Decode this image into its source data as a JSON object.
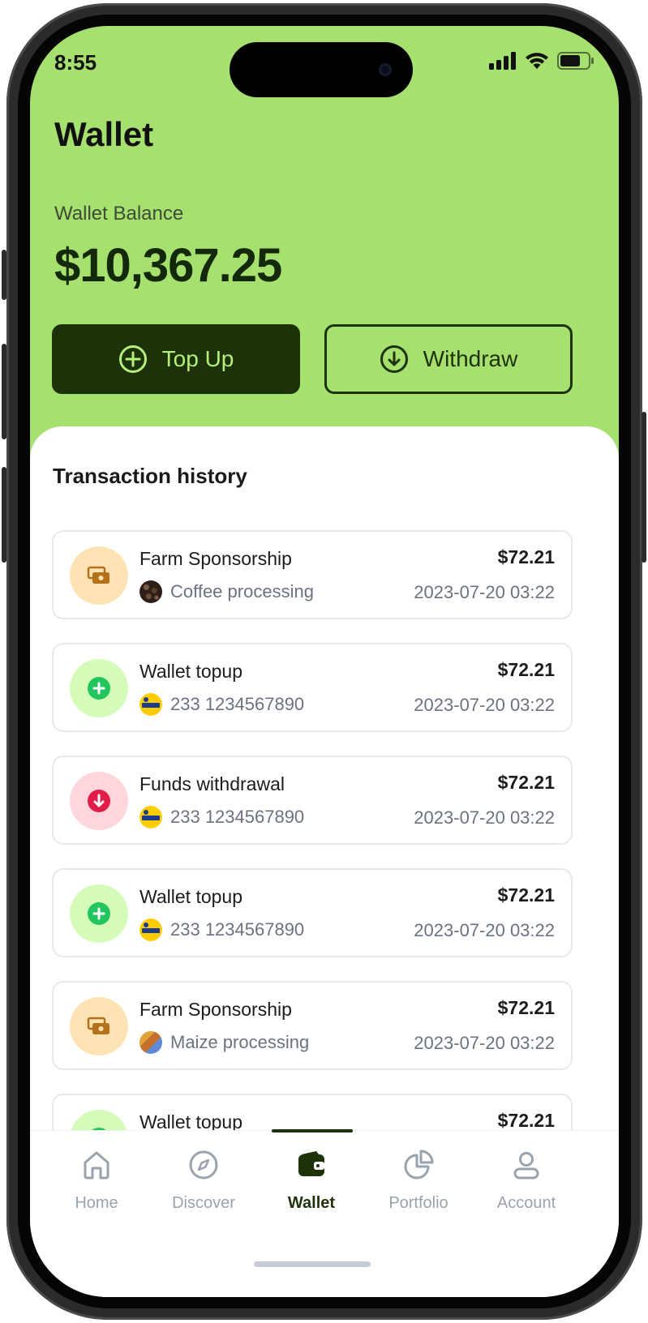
{
  "status_bar": {
    "time": "8:55",
    "icons": [
      "signal-icon",
      "wifi-icon",
      "battery-icon"
    ]
  },
  "header": {
    "title": "Wallet",
    "balance_label": "Wallet Balance",
    "balance": "$10,367.25"
  },
  "actions": {
    "top_up_label": "Top Up",
    "withdraw_label": "Withdraw"
  },
  "history": {
    "title": "Transaction history",
    "items": [
      {
        "name": "Farm Sponsorship",
        "detail": "Coffee processing",
        "amount": "$72.21",
        "date": "2023-07-20 03:22",
        "kind": "sponsorship",
        "icon": "cash-icon",
        "thumb": "coffee-thumb"
      },
      {
        "name": "Wallet topup",
        "detail": "233 1234567890",
        "amount": "$72.21",
        "date": "2023-07-20 03:22",
        "kind": "topup",
        "icon": "plus-icon",
        "thumb": "mtn-momo-logo"
      },
      {
        "name": "Funds withdrawal",
        "detail": "233 1234567890",
        "amount": "$72.21",
        "date": "2023-07-20 03:22",
        "kind": "withdrawal",
        "icon": "arrow-down-icon",
        "thumb": "mtn-momo-logo"
      },
      {
        "name": "Wallet topup",
        "detail": "233 1234567890",
        "amount": "$72.21",
        "date": "2023-07-20 03:22",
        "kind": "topup",
        "icon": "plus-icon",
        "thumb": "mtn-momo-logo"
      },
      {
        "name": "Farm Sponsorship",
        "detail": "Maize processing",
        "amount": "$72.21",
        "date": "2023-07-20 03:22",
        "kind": "sponsorship",
        "icon": "cash-icon",
        "thumb": "maize-thumb"
      },
      {
        "name": "Wallet topup",
        "detail": "",
        "amount": "$72.21",
        "date": "",
        "kind": "topup",
        "icon": "plus-icon",
        "thumb": ""
      }
    ]
  },
  "tabs": [
    {
      "label": "Home",
      "icon": "home-icon"
    },
    {
      "label": "Discover",
      "icon": "compass-icon"
    },
    {
      "label": "Wallet",
      "icon": "wallet-icon",
      "active": true
    },
    {
      "label": "Portfolio",
      "icon": "pie-chart-icon"
    },
    {
      "label": "Account",
      "icon": "user-icon"
    }
  ],
  "colors": {
    "header_green": "#a6e06e",
    "dark_green": "#1d3209",
    "topup_text": "#b5f07a",
    "sponsorship_badge": "#fde2b3",
    "sponsorship_icon": "#b5701a",
    "topup_badge": "#d4fbb8",
    "topup_icon": "#22c55e",
    "withdraw_badge": "#ffd6dc",
    "withdraw_icon": "#e11d48"
  }
}
